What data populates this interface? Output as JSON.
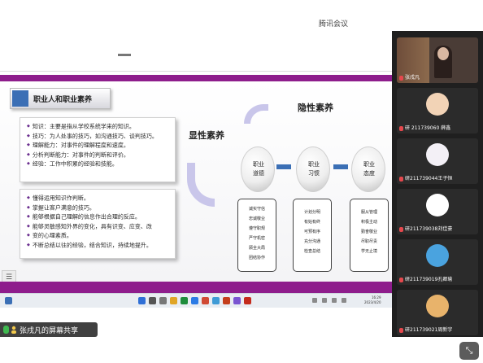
{
  "meeting": {
    "title": "腾讯会议"
  },
  "slide": {
    "section_title": "职业人和职业素养",
    "card_1_lines": [
      "知识：主要是指从学校系统学来的知识。",
      "技巧：为人处事的技巧，如沟通技巧、谈判技巧。",
      "理解能力：对事件的理解程度和速度。",
      "分析判断能力：对事件的判断和评价。",
      "经验：工作中积累的经验和技能。"
    ],
    "card_2_lines": [
      "懂得运用知识作判断。",
      "掌握让客户满意的技巧。",
      "能够根据自己理解的信息作出合理的反应。",
      "能够灵敏感知外界的变化，具有识变、应变、改",
      "变的心理素质。",
      "不断总结以往的经验，结合知识，持续地提升。"
    ],
    "label_explicit": "显性素养",
    "label_implicit": "隐性素养",
    "spheres": [
      {
        "line1": "职业",
        "line2": "道德"
      },
      {
        "line1": "职业",
        "line2": "习惯"
      },
      {
        "line1": "职业",
        "line2": "态度"
      }
    ],
    "box_1": [
      "诚实守信",
      "忠诚敬业",
      "遵守职规",
      "严守机密",
      "顾全大局",
      "团结协作"
    ],
    "box_2": [
      "计划分明",
      "有始有终",
      "可预有序",
      "充分沟通",
      "检查总结"
    ],
    "box_3": [
      "服从管理",
      "积极主动",
      "勤奋敬业",
      "尽职尽责",
      "学无止境"
    ]
  },
  "taskbar": {
    "time": "16:29",
    "date": "2023/4/20"
  },
  "share_indicator": {
    "label": "张戌凡的屏幕共享"
  },
  "participants": [
    {
      "name": "张戌凡",
      "type": "video"
    },
    {
      "name": "研 211739060 薛鑫",
      "type": "avatar",
      "color": "#f2d3b6"
    },
    {
      "name": "研211739044王子恒",
      "type": "avatar",
      "color": "#f3f0f6"
    },
    {
      "name": "研211739038刘佳豪",
      "type": "avatar",
      "color": "#ffffff"
    },
    {
      "name": "研211739019孔卿瑜",
      "type": "avatar",
      "color": "#4aa3df"
    },
    {
      "name": "研211739021周新宇",
      "type": "avatar",
      "color": "#e8b36b"
    }
  ],
  "controls": {
    "expand_icon": "expand-icon"
  }
}
